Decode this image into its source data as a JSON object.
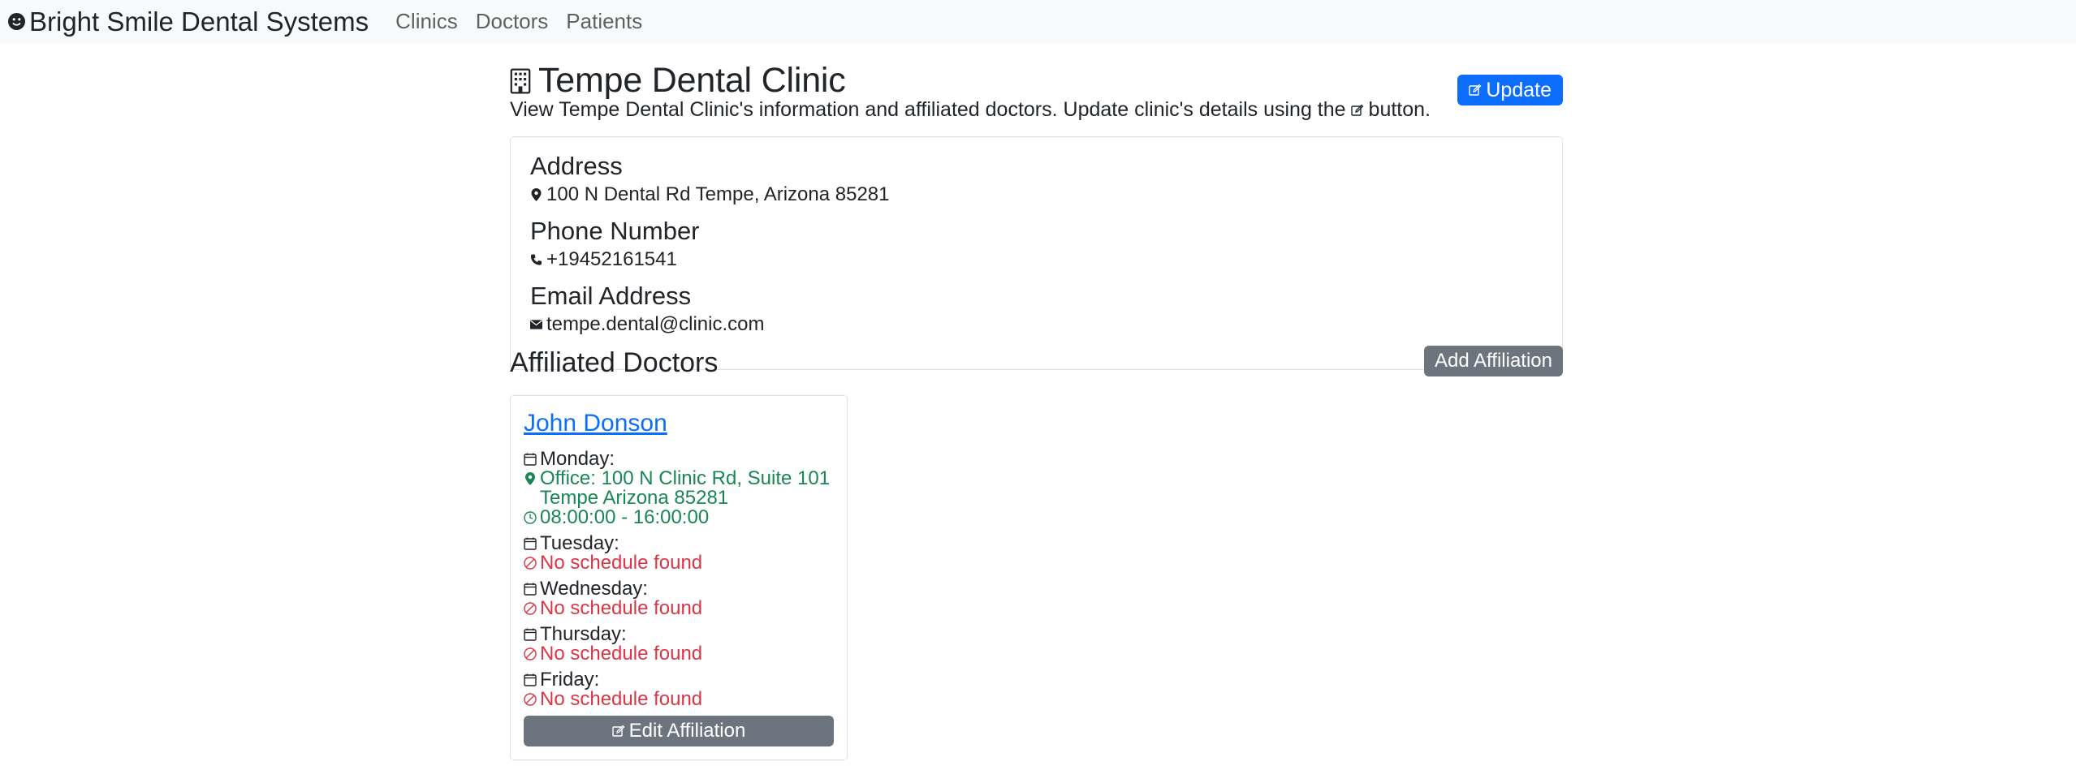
{
  "navbar": {
    "brand": "Bright Smile Dental Systems",
    "links": [
      "Clinics",
      "Doctors",
      "Patients"
    ]
  },
  "header": {
    "title": "Tempe Dental Clinic",
    "subtitle_before": "View Tempe Dental Clinic's information and affiliated doctors. Update clinic's details using the",
    "subtitle_after": "button.",
    "update_button": "Update"
  },
  "info": {
    "address_label": "Address",
    "address_value": "100 N Dental Rd Tempe, Arizona 85281",
    "phone_label": "Phone Number",
    "phone_value": "+19452161541",
    "email_label": "Email Address",
    "email_value": "tempe.dental@clinic.com"
  },
  "affiliations": {
    "title": "Affiliated Doctors",
    "add_button": "Add Affiliation",
    "doctor": {
      "name": "John Donson",
      "monday": "Monday:",
      "monday_office": "Office: 100 N Clinic Rd, Suite 101 Tempe Arizona 85281",
      "monday_hours": "08:00:00 - 16:00:00",
      "tuesday": "Tuesday:",
      "wednesday": "Wednesday:",
      "thursday": "Thursday:",
      "friday": "Friday:",
      "no_schedule": "No schedule found",
      "edit_button": "Edit Affiliation"
    }
  }
}
